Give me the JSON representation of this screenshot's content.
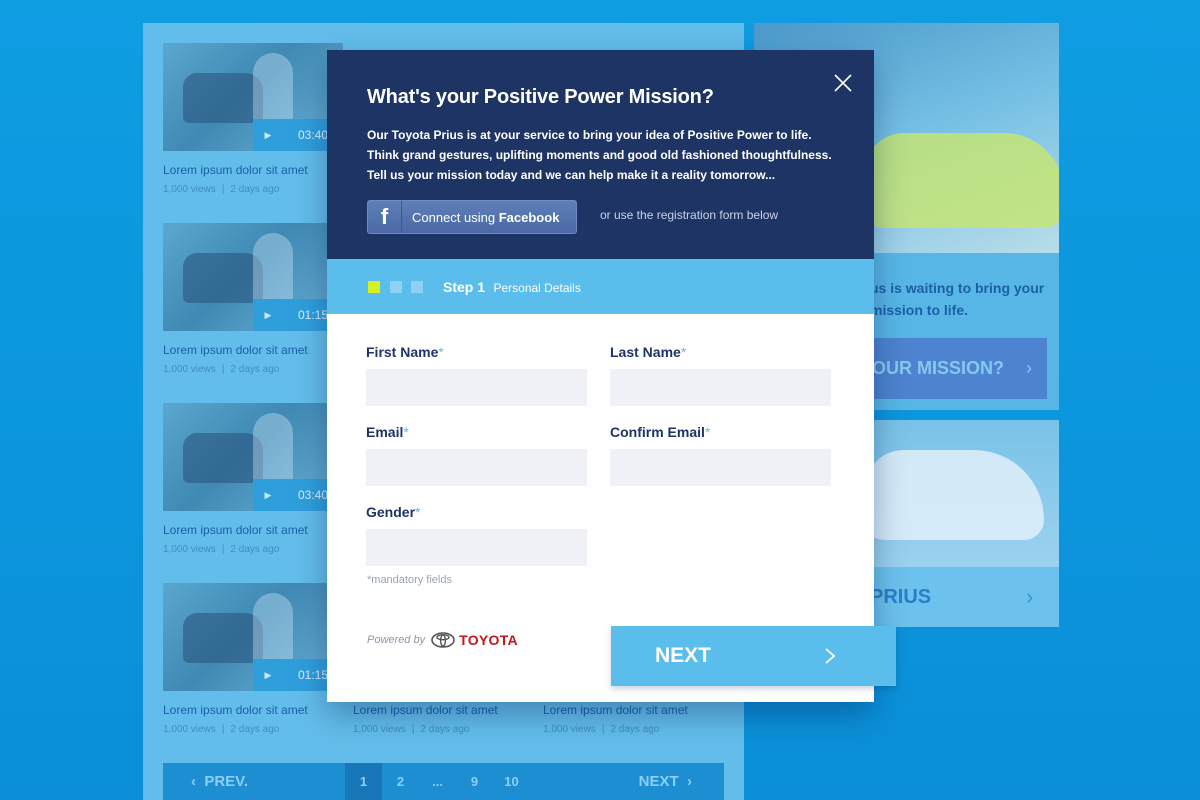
{
  "background": {
    "videos": [
      {
        "title": "Lorem ipsum dolor sit amet",
        "views": "1,000 views",
        "age": "2 days ago",
        "duration": "03:40"
      },
      {
        "title": "Lorem ipsum dolor sit amet",
        "views": "1,000 views",
        "age": "2 days ago",
        "duration": "01:15"
      },
      {
        "title": "Lorem ipsum dolor sit amet",
        "views": "1,000 views",
        "age": "2 days ago",
        "duration": "03:40"
      },
      {
        "title": "Lorem ipsum dolor sit amet",
        "views": "1,000 views",
        "age": "2 days ago",
        "duration": "01:15"
      },
      {
        "title": "Lorem ipsum dolor sit amet",
        "views": "1,000 views",
        "age": "2 days ago",
        "duration": ""
      },
      {
        "title": "Lorem ipsum dolor sit amet",
        "views": "1,000 views",
        "age": "2 days ago",
        "duration": ""
      }
    ],
    "separator": "|",
    "pager": {
      "prev": "PREV.",
      "next": "NEXT",
      "pages": [
        "1",
        "2",
        "...",
        "9",
        "10"
      ],
      "active_page": "1"
    },
    "promo_text": "us is waiting to bring your mission to life.",
    "mission_button": "OUR MISSION?",
    "prius_label": "PRIUS"
  },
  "modal": {
    "title": "What's your Positive Power Mission?",
    "description": "Our Toyota Prius is at your service to bring your idea of Positive Power to life. Think grand gestures, uplifting moments and good old fashioned thoughtfulness. Tell us your mission today and we can help make it a reality tomorrow...",
    "facebook": {
      "label_prefix": "Connect using ",
      "label_brand": "Facebook",
      "icon": "f"
    },
    "or_text": "or use the registration form below",
    "step": {
      "number": "Step 1",
      "name": "Personal Details",
      "total": 3,
      "current": 1
    },
    "colors": {
      "step_active": "#d7f021",
      "step_inactive": "#8dd1f3",
      "accent": "#5bbdeb",
      "header_bg": "#1e3465"
    },
    "fields": {
      "first_name": {
        "label": "First Name",
        "value": ""
      },
      "last_name": {
        "label": "Last Name",
        "value": ""
      },
      "email": {
        "label": "Email",
        "value": ""
      },
      "confirm_email": {
        "label": "Confirm Email",
        "value": ""
      },
      "gender": {
        "label": "Gender",
        "value": ""
      }
    },
    "required_mark": "*",
    "mandatory_note": "*mandatory fields",
    "powered_by": "Powered by",
    "brand": "TOYOTA",
    "next_label": "NEXT"
  }
}
